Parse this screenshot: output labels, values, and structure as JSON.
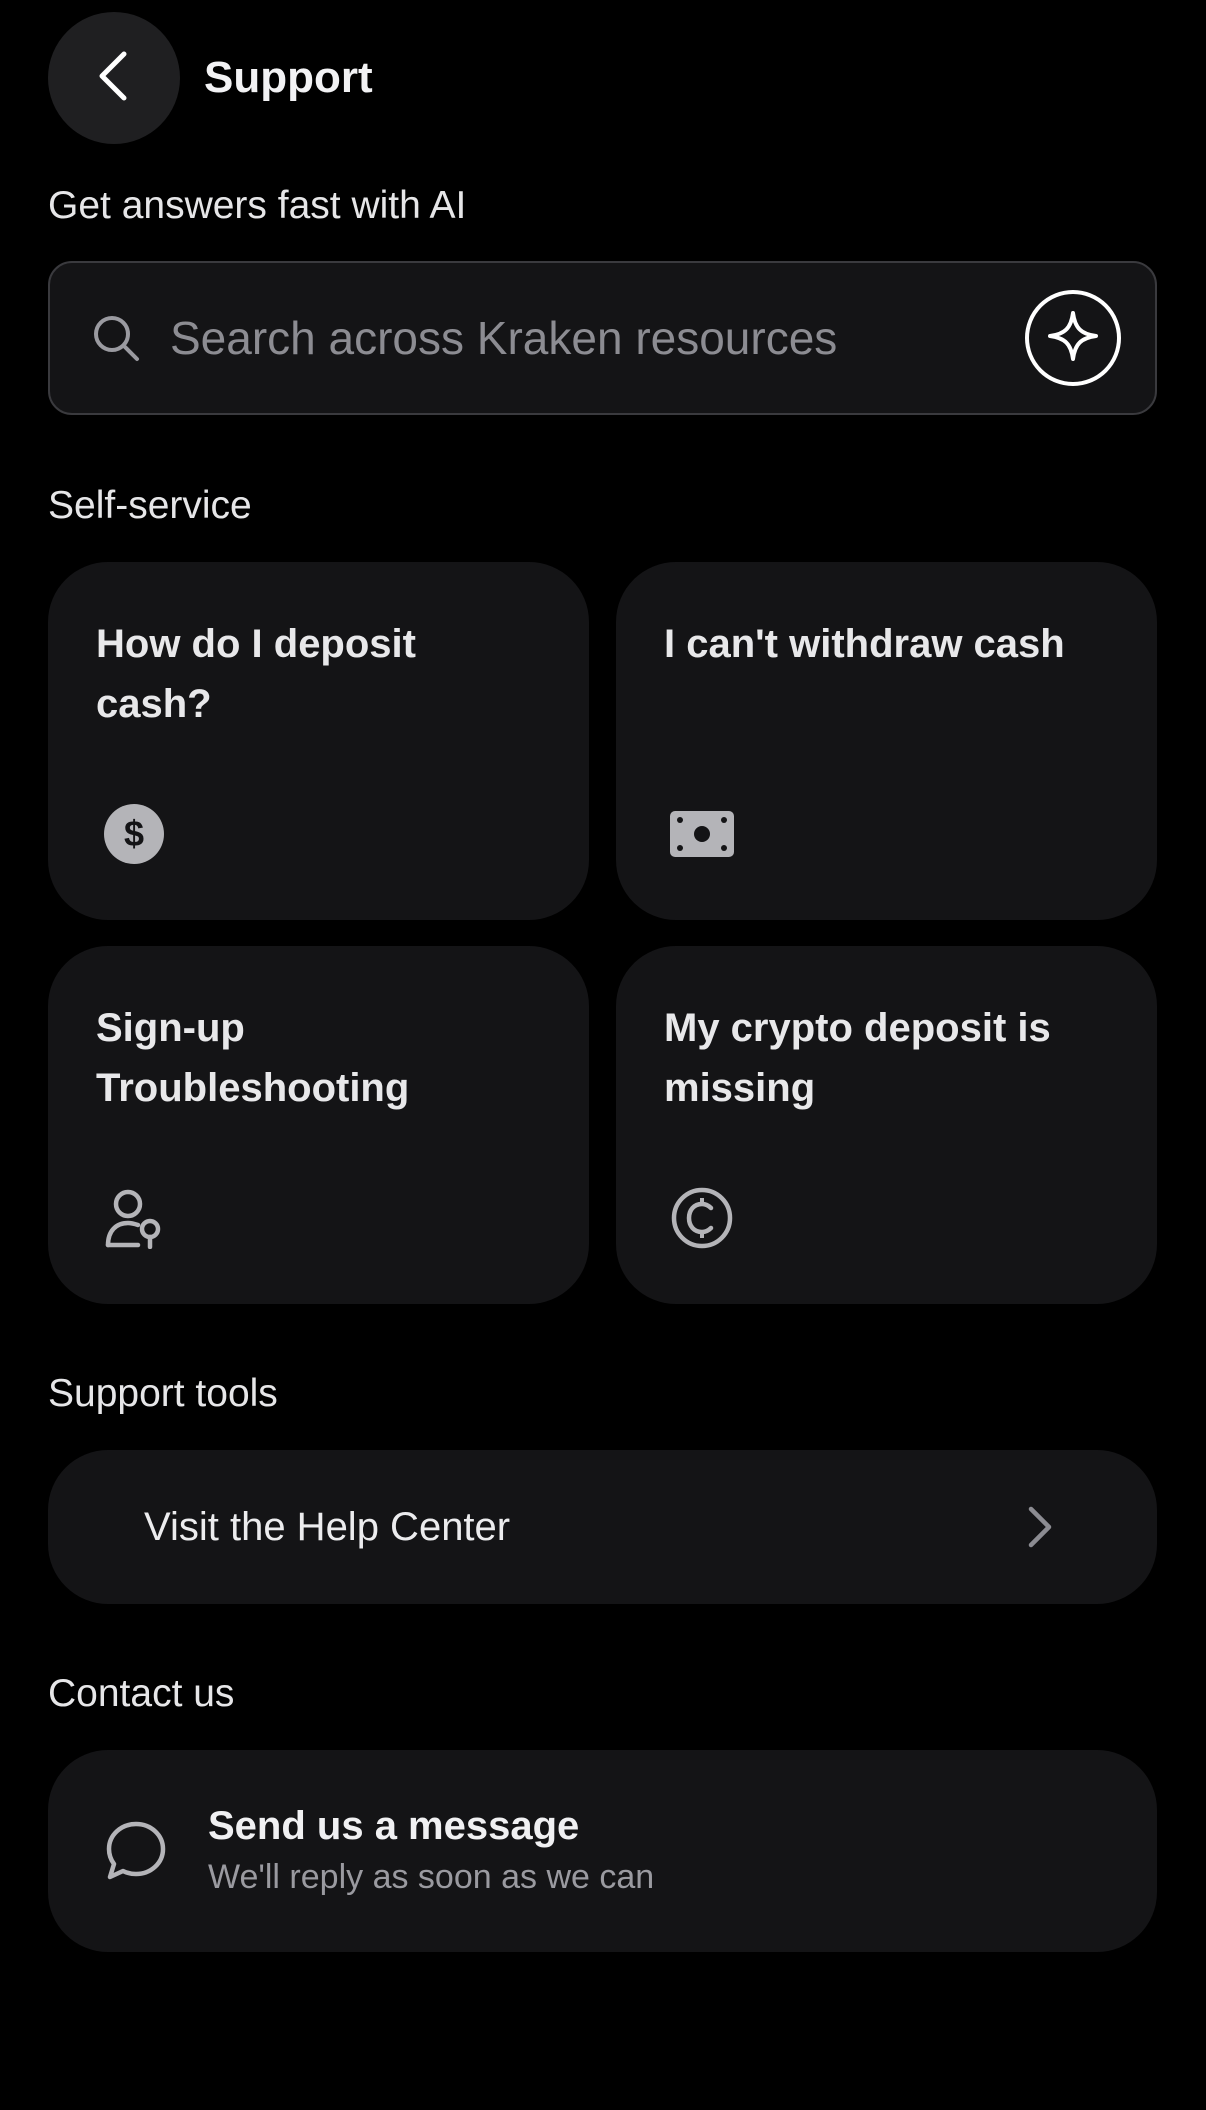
{
  "header": {
    "title": "Support",
    "back_icon": "chevron-left-icon"
  },
  "ai_section": {
    "label": "Get answers fast with AI",
    "search": {
      "placeholder": "Search across Kraken resources",
      "value": "",
      "icon": "search-icon",
      "ai_icon": "sparkle-icon"
    }
  },
  "self_service": {
    "label": "Self-service",
    "cards": [
      {
        "title": "How do I deposit cash?",
        "icon": "dollar-coin-icon"
      },
      {
        "title": "I can't withdraw cash",
        "icon": "banknote-icon"
      },
      {
        "title": "Sign-up Troubleshooting",
        "icon": "user-lock-icon"
      },
      {
        "title": "My crypto deposit is missing",
        "icon": "crypto-coin-icon"
      }
    ]
  },
  "support_tools": {
    "label": "Support tools",
    "help_center": {
      "label": "Visit the Help Center",
      "icon": "chevron-right-icon"
    }
  },
  "contact": {
    "label": "Contact us",
    "message": {
      "title": "Send us a message",
      "subtitle": "We'll reply as soon as we can",
      "icon": "chat-bubble-icon"
    }
  },
  "colors": {
    "background": "#000000",
    "card": "#141416",
    "text": "#ececee",
    "muted": "#9a9aa0",
    "icon_gray": "#b4b4b8"
  }
}
